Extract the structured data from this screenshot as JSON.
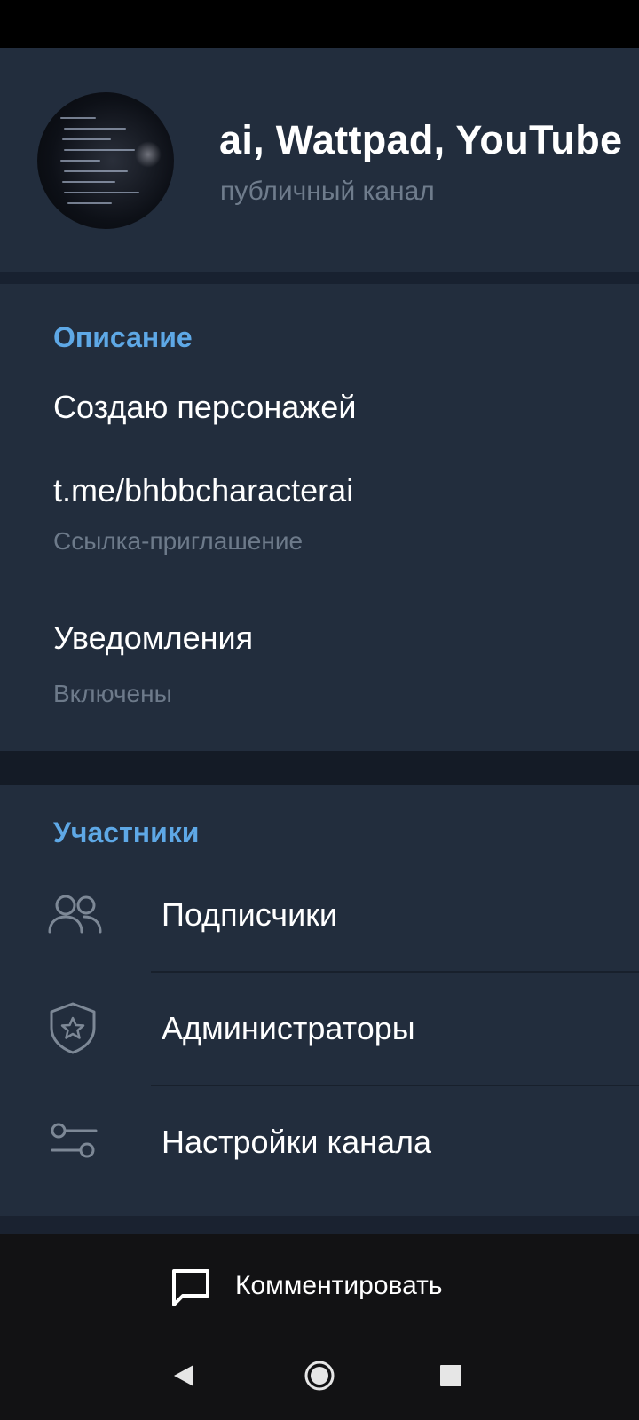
{
  "header": {
    "title": "ai, Wattpad, YouTube",
    "subtitle": "публичный канал"
  },
  "info": {
    "description_title": "Описание",
    "description_text": "Создаю персонажей",
    "invite_link": "t.me/bhbbcharacterai",
    "invite_link_caption": "Ссылка-приглашение",
    "notifications_label": "Уведомления",
    "notifications_status": "Включены"
  },
  "members": {
    "section_title": "Участники",
    "items": [
      {
        "label": "Подписчики",
        "icon": "people-icon"
      },
      {
        "label": "Администраторы",
        "icon": "shield-star-icon"
      },
      {
        "label": "Настройки канала",
        "icon": "sliders-icon"
      }
    ]
  },
  "bottom": {
    "comment_label": "Комментировать",
    "comment_icon": "chat-bubble-icon"
  },
  "navbar": {
    "icons": [
      "back-icon",
      "home-icon",
      "recents-icon"
    ]
  },
  "colors": {
    "accent": "#5ea8e6",
    "panel": "#222d3d",
    "background": "#1a2230",
    "muted_text": "#6d7a8a"
  }
}
